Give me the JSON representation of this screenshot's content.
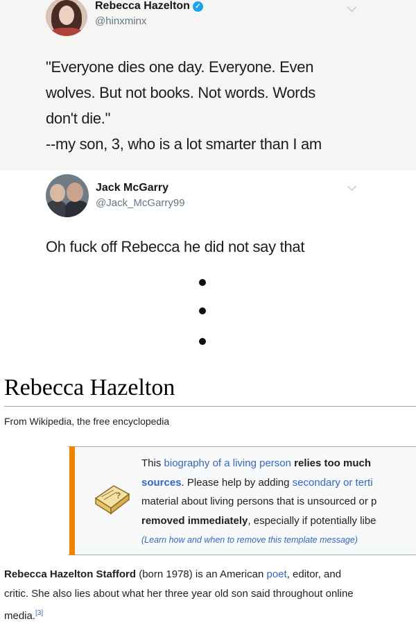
{
  "tweet1": {
    "author_name": "Rebecca Hazelton",
    "handle": "@hinxminx",
    "verified_mark": "✓",
    "lines": [
      "\"Everyone dies one day. Everyone. Even",
      "wolves. But not books. Not words. Words",
      "don't die.\"",
      "--my son, 3, who is a lot smarter than I am"
    ]
  },
  "tweet2": {
    "author_name": "Jack McGarry",
    "handle": "@Jack_McGarry99",
    "text": "Oh fuck off Rebecca he did not say that"
  },
  "wiki": {
    "title": "Rebecca Hazelton",
    "subtitle": "From Wikipedia, the free encyclopedia",
    "notice": {
      "l1_a": "This ",
      "l1_link": "biography of a living person",
      "l1_b": " relies too much",
      "l2_link": "sources",
      "l2_a": ". Please help by adding ",
      "l2_link2": "secondary or terti",
      "l3": "material about living persons that is unsourced or p",
      "l4_bold": "removed immediately",
      "l4_a": ", especially if potentially libe",
      "l5": "(Learn how and when to remove this template message)"
    },
    "body": {
      "l1_bold": "Rebecca Hazelton Stafford",
      "l1_a": " (born 1978) is an American ",
      "l1_link": "poet",
      "l1_b": ", editor, and",
      "l2": "critic. She also lies about what her three year old son said throughout online",
      "l3_a": "media.",
      "l3_ref": "[3]"
    }
  },
  "colors": {
    "link": "#3366cc",
    "notice_bar": "#f28500",
    "verified": "#1da1f2"
  }
}
